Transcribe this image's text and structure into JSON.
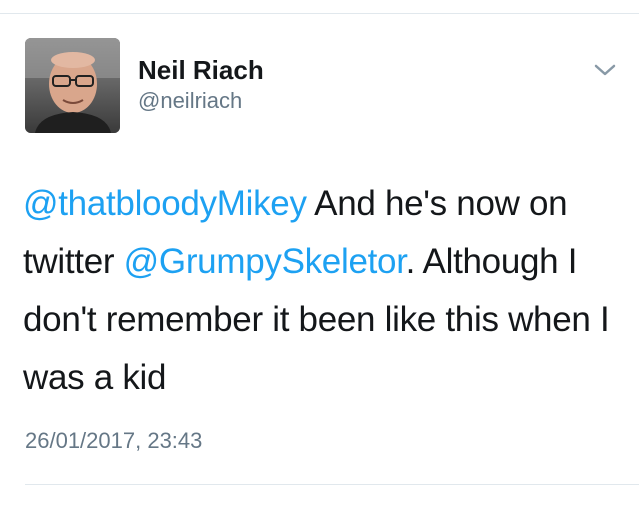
{
  "tweet": {
    "author": {
      "name": "Neil Riach",
      "handle": "@neilriach"
    },
    "text_parts": [
      {
        "text": "@thatbloodyMikey",
        "type": "mention"
      },
      {
        "text": " And he's now on twitter ",
        "type": "text"
      },
      {
        "text": "@GrumpySkeletor",
        "type": "mention"
      },
      {
        "text": ". Although I don't remember it been like this when I was a kid",
        "type": "text"
      }
    ],
    "timestamp": "26/01/2017, 23:43"
  },
  "icons": {
    "menu": "chevron-down-icon",
    "avatar": "profile-photo"
  },
  "colors": {
    "mention": "#1da1f2",
    "text": "#14171a",
    "muted": "#657786",
    "divider": "#e1e8ed"
  }
}
